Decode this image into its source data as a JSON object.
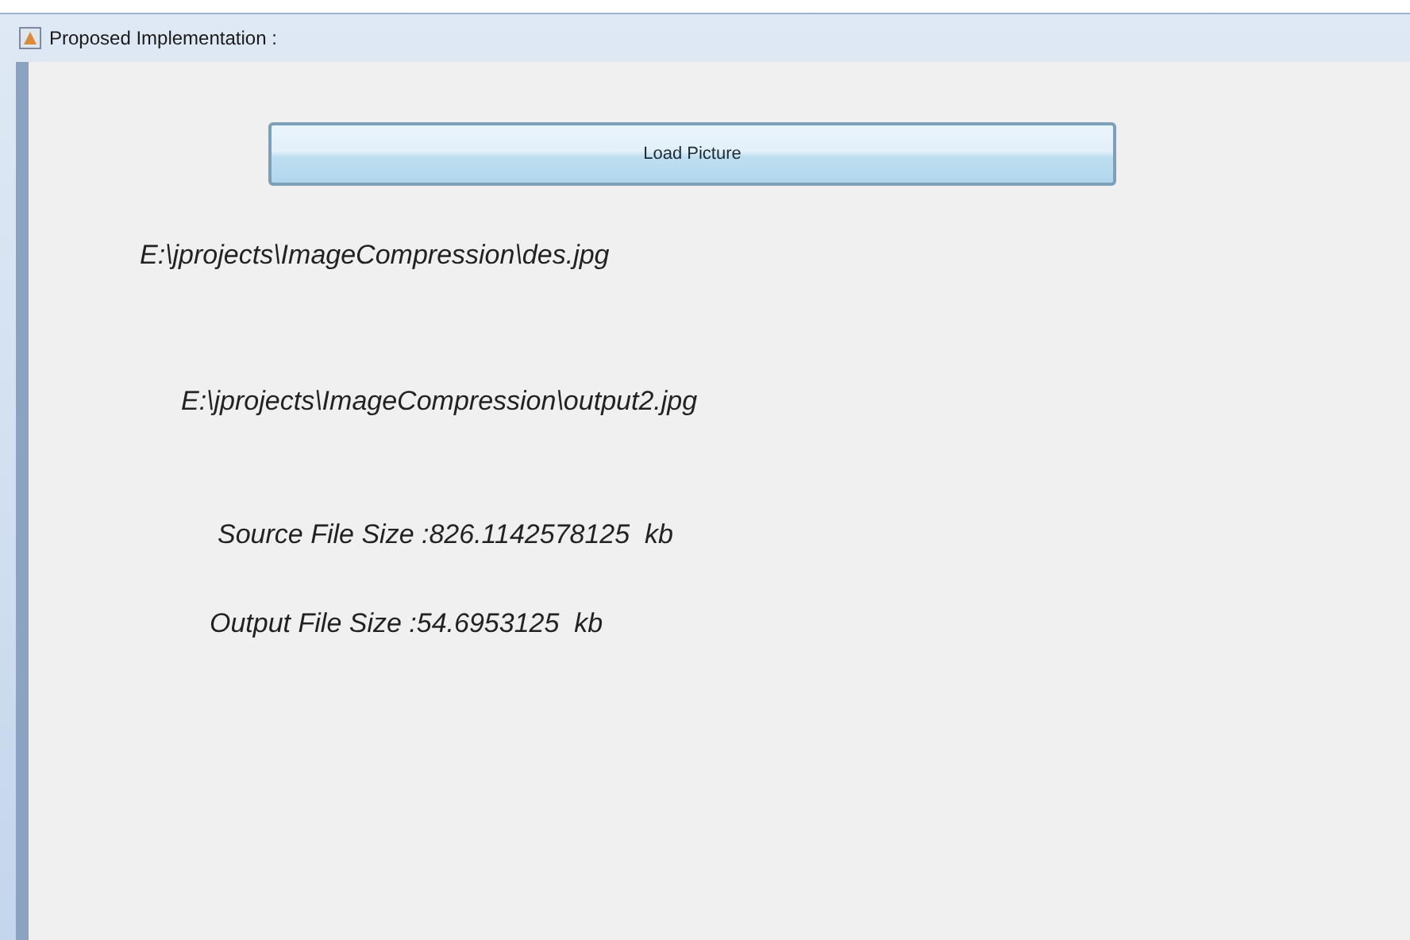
{
  "window": {
    "title": "Proposed Implementation :"
  },
  "button": {
    "label": "Load Picture"
  },
  "labels": [
    "E:\\jprojects\\ImageCompression\\des.jpg",
    "E:\\jprojects\\ImageCompression\\output2.jpg",
    "Source File Size :826.1142578125  kb",
    "Output File Size :54.6953125  kb"
  ]
}
